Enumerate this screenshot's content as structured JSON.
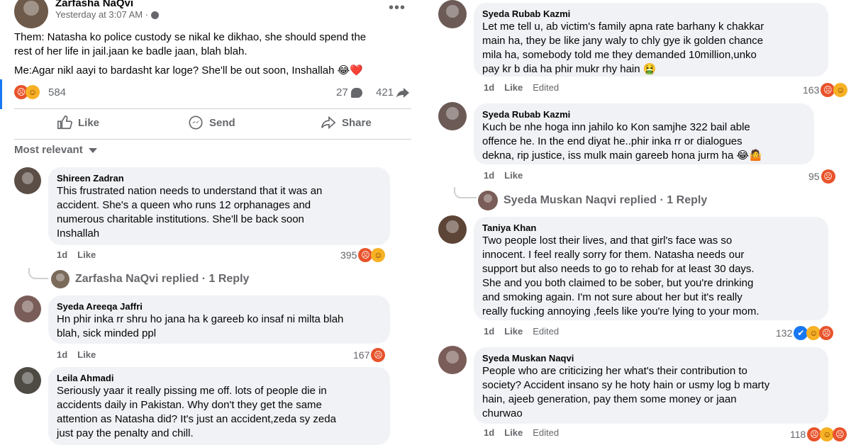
{
  "post": {
    "author": "Zarfasha NaQvi",
    "time": "Yesterday at 3:07 AM ·",
    "more": "•••",
    "line1": "Them: Natasha ko police custody se nikal ke dikhao, she should spend the",
    "line2": "rest of her life in jail.jaan ke badle jaan, blah blah.",
    "line3": "Me:Agar nikl aayi to bardasht kar loge? She'll be out soon, Inshallah 😂❤️",
    "reaction_count": "584",
    "comment_count": "27",
    "share_count": "421",
    "actions": {
      "like": "Like",
      "send": "Send",
      "share": "Share"
    },
    "sort_label": "Most relevant"
  },
  "left_comments": [
    {
      "name": "Shireen Zadran",
      "lines": [
        "This frustrated nation needs to understand that it was an",
        "accident. She's a queen who runs 12 orphanages and",
        "numerous charitable institutions. She'll be back soon",
        "Inshallah"
      ],
      "time": "1d",
      "like": "Like",
      "count": "395"
    },
    {
      "name": "Syeda Areeqa Jaffri",
      "lines": [
        "Hn phir inka rr shru ho jana ha k gareeb ko insaf ni milta blah",
        "blah, sick minded ppl"
      ],
      "time": "1d",
      "like": "Like",
      "count": "167"
    },
    {
      "name": "Leila Ahmadi",
      "lines": [
        "Seriously yaar it really pissing me off. lots of people die in",
        "accidents daily in Pakistan. Why don't they get the same",
        "attention as Natasha did? It's just an accident,zeda sy zeda",
        "just pay the penalty and chill."
      ]
    }
  ],
  "left_reply": {
    "text": "Zarfasha NaQvi replied · 1 Reply"
  },
  "right_comments": [
    {
      "name": "Syeda Rubab Kazmi",
      "lines": [
        "Let me tell u, ab victim's family apna rate barhany k chakkar",
        "main ha, they be like jany waly to chly gye ik golden chance",
        "mila ha, somebody told me they demanded 10million,unko",
        "pay kr b dia ha phir mukr rhy hain 🤮"
      ],
      "time": "1d",
      "like": "Like",
      "edited": "Edited",
      "count": "163"
    },
    {
      "name": "Syeda Rubab Kazmi",
      "lines": [
        "Kuch be nhe hoga inn jahilo ko Kon samjhe 322 bail able",
        "offence he. In the end diyat he..phir inka rr or dialogues",
        "dekna, rip justice, iss mulk main gareeb hona jurm ha 😂🤷"
      ],
      "time": "1d",
      "like": "Like",
      "edited": "",
      "count": "95"
    },
    {
      "name": "Taniya Khan",
      "lines": [
        "Two people lost their lives, and that girl's face was so",
        "innocent. I feel really sorry for them. Natasha needs our",
        "support but also needs to go to rehab for at least 30 days.",
        "She and you both claimed to be sober, but you're drinking",
        "and smoking again. I'm not sure about her but it's really",
        "really fucking annoying ,feels like you're lying to your mom."
      ],
      "time": "1d",
      "like": "Like",
      "edited": "Edited",
      "count": "132"
    },
    {
      "name": "Syeda Muskan Naqvi",
      "lines": [
        "People who are criticizing her what's their contribution to",
        "society? Accident insano sy he hoty hain or usmy log b marty",
        "hain, ajeeb generation, pay them some money or jaan",
        "churwao"
      ],
      "time": "1d",
      "like": "Like",
      "edited": "Edited",
      "count": "118"
    }
  ],
  "right_reply": {
    "text": "Syeda Muskan Naqvi replied · 1 Reply"
  },
  "colors": {
    "angry": "#e8532b",
    "haha": "#f7b125",
    "like": "#1877f2",
    "bubble": "#f0f2f5",
    "secondary_text": "#65676b"
  }
}
